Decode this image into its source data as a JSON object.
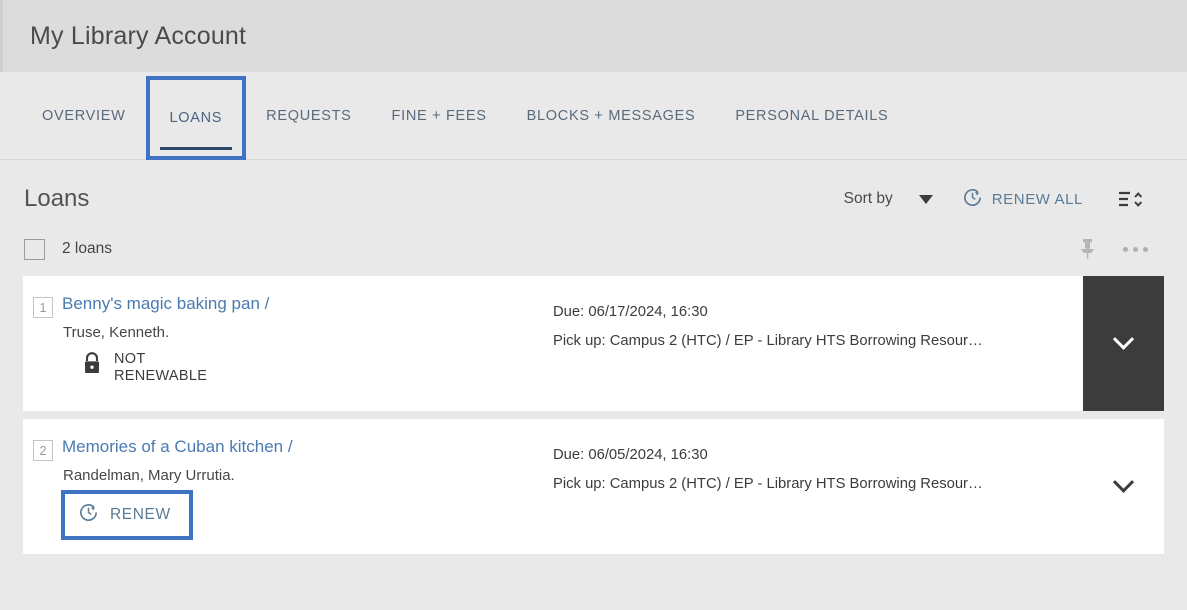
{
  "header": {
    "title": "My Library Account"
  },
  "tabs": [
    {
      "label": "OVERVIEW",
      "active": false,
      "focused": false
    },
    {
      "label": "LOANS",
      "active": true,
      "focused": true
    },
    {
      "label": "REQUESTS",
      "active": false,
      "focused": false
    },
    {
      "label": "FINE + FEES",
      "active": false,
      "focused": false
    },
    {
      "label": "BLOCKS + MESSAGES",
      "active": false,
      "focused": false
    },
    {
      "label": "PERSONAL DETAILS",
      "active": false,
      "focused": false
    }
  ],
  "toolbar": {
    "section_title": "Loans",
    "sort_by_label": "Sort by",
    "renew_all_label": "RENEW ALL",
    "sort_icon": "sort-list-icon",
    "caret_icon": "chevron-down-icon",
    "renew_all_icon": "clock-renew-icon"
  },
  "select_row": {
    "count_label": "2 loans",
    "pin_icon": "pin-icon",
    "more_icon": "ellipsis-icon"
  },
  "loans": [
    {
      "number": "1",
      "title": "Benny's magic baking pan /",
      "author": "Truse, Kenneth.",
      "action_type": "locked",
      "action_icon": "lock-icon",
      "action_label_line1": "NOT",
      "action_label_line2": "RENEWABLE",
      "due": "Due: 06/17/2024, 16:30",
      "pickup": "Pick up: Campus 2 (HTC) / EP - Library HTS Borrowing Resour…",
      "expander_icon": "chevron-down-icon",
      "expander_highlighted": true
    },
    {
      "number": "2",
      "title": "Memories of a Cuban kitchen /",
      "author": "Randelman, Mary Urrutia.",
      "action_type": "renew",
      "action_icon": "clock-renew-icon",
      "action_label": "RENEW",
      "due": "Due: 06/05/2024, 16:30",
      "pickup": "Pick up: Campus 2 (HTC) / EP - Library HTS Borrowing Resour…",
      "expander_icon": "chevron-down-icon",
      "expander_highlighted": false
    }
  ],
  "colors": {
    "focus_blue": "#3f72c2",
    "link_blue": "#4a7bb0",
    "action_blue": "#5a7a96",
    "dark_panel": "#3c3c3c",
    "header_bg": "#dcdcdc",
    "page_bg": "#e9e9e9"
  }
}
